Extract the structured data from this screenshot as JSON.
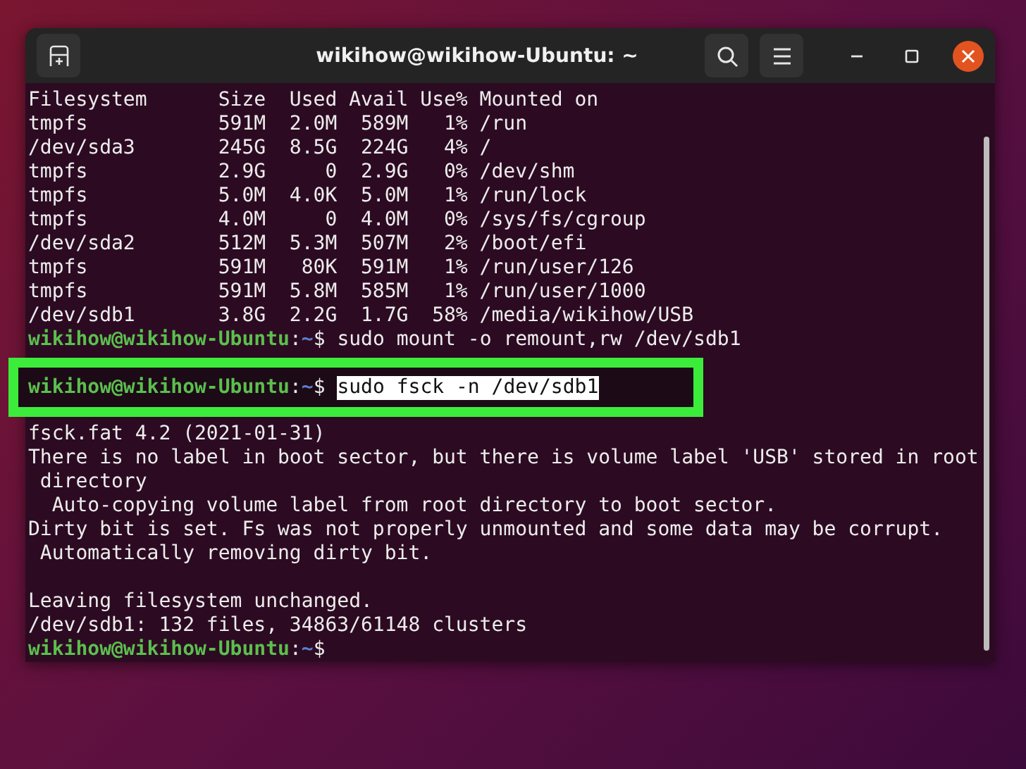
{
  "window": {
    "title": "wikihow@wikihow-Ubuntu: ~"
  },
  "lines": [
    {
      "kind": "output",
      "text": "Filesystem      Size  Used Avail Use% Mounted on"
    },
    {
      "kind": "output",
      "text": "tmpfs           591M  2.0M  589M   1% /run"
    },
    {
      "kind": "output",
      "text": "/dev/sda3       245G  8.5G  224G   4% /"
    },
    {
      "kind": "output",
      "text": "tmpfs           2.9G     0  2.9G   0% /dev/shm"
    },
    {
      "kind": "output",
      "text": "tmpfs           5.0M  4.0K  5.0M   1% /run/lock"
    },
    {
      "kind": "output",
      "text": "tmpfs           4.0M     0  4.0M   0% /sys/fs/cgroup"
    },
    {
      "kind": "output",
      "text": "/dev/sda2       512M  5.3M  507M   2% /boot/efi"
    },
    {
      "kind": "output",
      "text": "tmpfs           591M   80K  591M   1% /run/user/126"
    },
    {
      "kind": "output",
      "text": "tmpfs           591M  5.8M  585M   1% /run/user/1000"
    },
    {
      "kind": "output",
      "text": "/dev/sdb1       3.8G  2.2G  1.7G  58% /media/wikihow/USB"
    },
    {
      "kind": "prompt",
      "user": "wikihow@wikihow-Ubuntu",
      "separator": ":",
      "path": "~",
      "symbol": "$",
      "command": "sudo mount -o remount,rw /dev/sdb1",
      "highlighted": false
    },
    {
      "kind": "prompt",
      "user": "wikihow@wikihow-Ubuntu",
      "separator": ":",
      "path": "~",
      "symbol": "$",
      "command": "sudo fsck -n /dev/sdb1",
      "highlighted": true,
      "command_selected": true
    },
    {
      "kind": "output",
      "text": "fsck.fat 4.2 (2021-01-31)"
    },
    {
      "kind": "output",
      "text": "There is no label in boot sector, but there is volume label 'USB' stored in root"
    },
    {
      "kind": "output",
      "text": " directory"
    },
    {
      "kind": "output",
      "text": "  Auto-copying volume label from root directory to boot sector."
    },
    {
      "kind": "output",
      "text": "Dirty bit is set. Fs was not properly unmounted and some data may be corrupt."
    },
    {
      "kind": "output",
      "text": " Automatically removing dirty bit."
    },
    {
      "kind": "blank"
    },
    {
      "kind": "output",
      "text": "Leaving filesystem unchanged."
    },
    {
      "kind": "output",
      "text": "/dev/sdb1: 132 files, 34863/61148 clusters"
    },
    {
      "kind": "prompt",
      "user": "wikihow@wikihow-Ubuntu",
      "separator": ":",
      "path": "~",
      "symbol": "$",
      "highlighted": false
    }
  ]
}
